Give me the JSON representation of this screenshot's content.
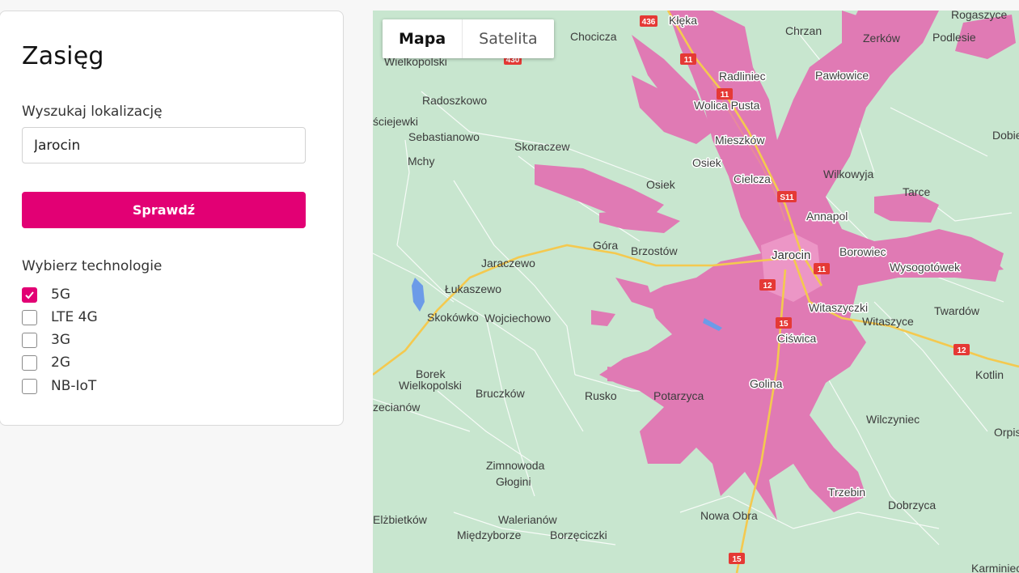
{
  "panel": {
    "title": "Zasięg",
    "search_label": "Wyszukaj lokalizację",
    "search_value": "Jarocin",
    "check_button": "Sprawdź",
    "tech_label": "Wybierz technologie",
    "technologies": [
      {
        "label": "5G",
        "checked": true
      },
      {
        "label": "LTE 4G",
        "checked": false
      },
      {
        "label": "3G",
        "checked": false
      },
      {
        "label": "2G",
        "checked": false
      },
      {
        "label": "NB-IoT",
        "checked": false
      }
    ]
  },
  "map": {
    "tabs": [
      {
        "label": "Mapa",
        "active": true
      },
      {
        "label": "Satelita",
        "active": false
      }
    ],
    "coverage_color": "#e07ab4",
    "places": [
      "Kłęka",
      "Rogaszyce",
      "Chocicza",
      "Chrzan",
      "Zerków",
      "Podlesie",
      "Wielkopolski",
      "Radliniec",
      "Pawłowice",
      "Radoszkowo",
      "Wolica Pusta",
      "ściejewki",
      "Sebastianowo",
      "Mieszków",
      "Dobie",
      "Skoraczew",
      "Mchy",
      "Osiek",
      "Cielcza",
      "Wilkowyja",
      "Osiek",
      "Tarce",
      "Annapol",
      "Góra",
      "Brzostów",
      "Jaraczewo",
      "Jarocin",
      "Borowiec",
      "Wysogotówek",
      "Łukaszewo",
      "Witaszyczki",
      "Twardów",
      "Skokówko",
      "Wojciechowo",
      "Witaszyce",
      "Ciświca",
      "Borek",
      "Wielkopolski",
      "Golina",
      "Kotlin",
      "Bruczków",
      "Rusko",
      "Potarzyca",
      "zecianów",
      "Wilczyniec",
      "Orpis",
      "Zimnowoda",
      "Głogini",
      "Trzebin",
      "Walerianów",
      "Nowa Obra",
      "Dobrzyca",
      "Elżbietków",
      "Międzyborze",
      "Borzęciczki",
      "Karminiec"
    ],
    "road_shields": [
      "436",
      "11",
      "11",
      "430",
      "S11",
      "11",
      "12",
      "15",
      "12",
      "15"
    ]
  }
}
